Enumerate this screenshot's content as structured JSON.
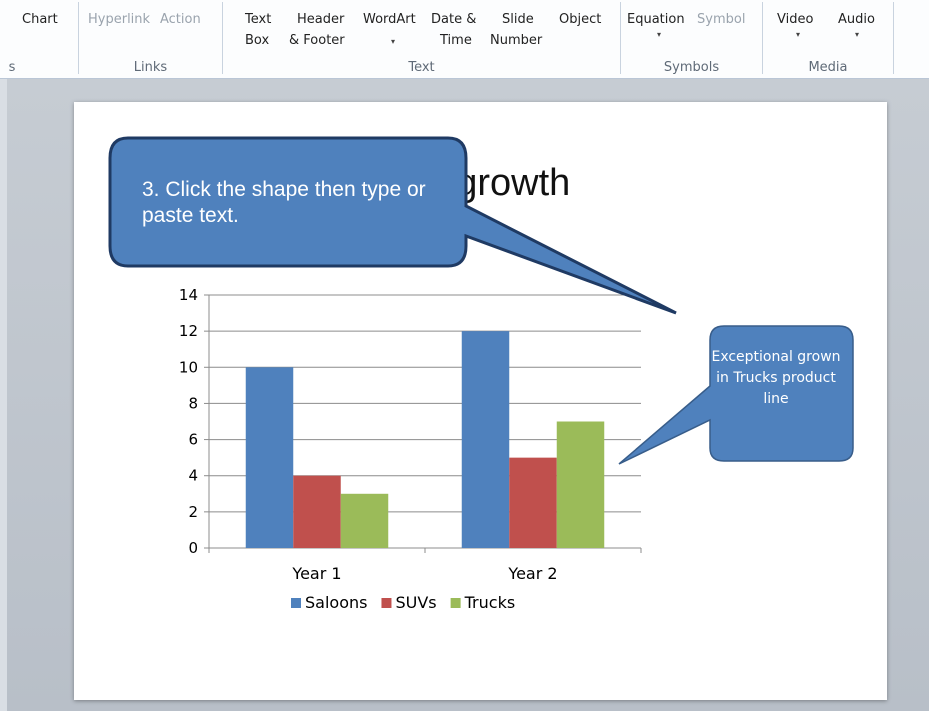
{
  "ribbon": {
    "items": [
      {
        "id": "chart",
        "label": "Chart",
        "disabled": false
      },
      {
        "id": "hyperlink",
        "label": "Hyperlink",
        "disabled": true
      },
      {
        "id": "action",
        "label": "Action",
        "disabled": true
      },
      {
        "id": "text-box",
        "line1": "Text",
        "line2": "Box"
      },
      {
        "id": "header-footer",
        "line1": "Header",
        "line2": "& Footer"
      },
      {
        "id": "wordart",
        "line1": "WordArt"
      },
      {
        "id": "date-time",
        "line1": "Date &",
        "line2": "Time"
      },
      {
        "id": "slide-number",
        "line1": "Slide",
        "line2": "Number"
      },
      {
        "id": "object",
        "line1": "Object"
      },
      {
        "id": "equation",
        "label": "Equation"
      },
      {
        "id": "symbol",
        "label": "Symbol",
        "disabled": true
      },
      {
        "id": "video",
        "label": "Video"
      },
      {
        "id": "audio",
        "label": "Audio"
      }
    ],
    "groups": {
      "partial": "s",
      "links": "Links",
      "text": "Text",
      "symbols": "Symbols",
      "media": "Media"
    },
    "dropdown_glyph": "▾"
  },
  "slide": {
    "title": "ear growth"
  },
  "callouts": {
    "main": "3. Click the shape then type or paste text.",
    "side": "Exceptional grown in Trucks product line"
  },
  "chart_data": {
    "type": "bar",
    "categories": [
      "Year 1",
      "Year 2"
    ],
    "series": [
      {
        "name": "Saloons",
        "values": [
          10,
          12
        ],
        "color": "#4f81bd"
      },
      {
        "name": "SUVs",
        "values": [
          4,
          5
        ],
        "color": "#c0504d"
      },
      {
        "name": "Trucks",
        "values": [
          3,
          7
        ],
        "color": "#9bbb59"
      }
    ],
    "ylim": [
      0,
      14
    ],
    "yticks": [
      0,
      2,
      4,
      6,
      8,
      10,
      12,
      14
    ],
    "grid": true,
    "legend": "bottom"
  },
  "colors": {
    "callout_fill": "#4f81bd",
    "callout_border": "#1f3a63",
    "side_callout_border": "#385d8a"
  }
}
